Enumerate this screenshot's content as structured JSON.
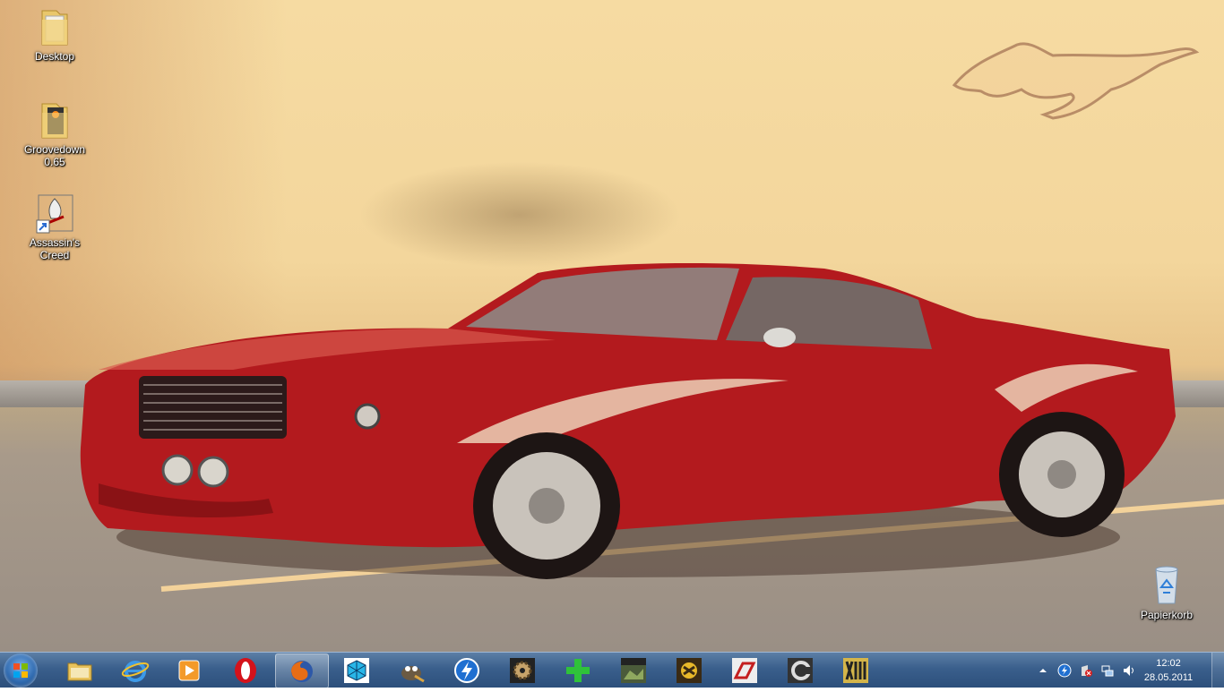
{
  "desktop": {
    "icons": [
      {
        "label": "Desktop",
        "icon": "folder-icon"
      },
      {
        "label": "Groovedown 0.65",
        "icon": "folder-icon"
      },
      {
        "label": "Assassin's Creed",
        "icon": "game-shortcut-icon"
      },
      {
        "label": "Papierkorb",
        "icon": "recycle-bin-icon"
      }
    ]
  },
  "taskbar": {
    "start_icon": "windows-orb-icon",
    "pinned": [
      {
        "name": "explorer",
        "icon": "folder-icon"
      },
      {
        "name": "internet-explorer",
        "icon": "ie-icon"
      },
      {
        "name": "media-player",
        "icon": "media-player-icon"
      },
      {
        "name": "opera",
        "icon": "opera-icon"
      },
      {
        "name": "firefox",
        "icon": "firefox-icon",
        "active": true
      },
      {
        "name": "app-cube",
        "icon": "cube-app-icon"
      },
      {
        "name": "gimp",
        "icon": "gimp-icon"
      },
      {
        "name": "download-manager",
        "icon": "lightning-icon"
      },
      {
        "name": "app-gear",
        "icon": "gear-app-icon"
      },
      {
        "name": "app-plus",
        "icon": "plus-app-icon"
      },
      {
        "name": "battlefield",
        "icon": "battlefield-icon"
      },
      {
        "name": "game-yellow",
        "icon": "game-icon"
      },
      {
        "name": "need-for-speed",
        "icon": "nfs-icon"
      },
      {
        "name": "app-crescent",
        "icon": "crescent-app-icon"
      },
      {
        "name": "xiii",
        "icon": "xiii-icon"
      }
    ],
    "tray": {
      "clock_time": "12:02",
      "clock_date": "28.05.2011"
    }
  },
  "colors": {
    "taskbar": "#3a5f8c",
    "car": "#b31a1e",
    "sky": "#f6dba2"
  }
}
